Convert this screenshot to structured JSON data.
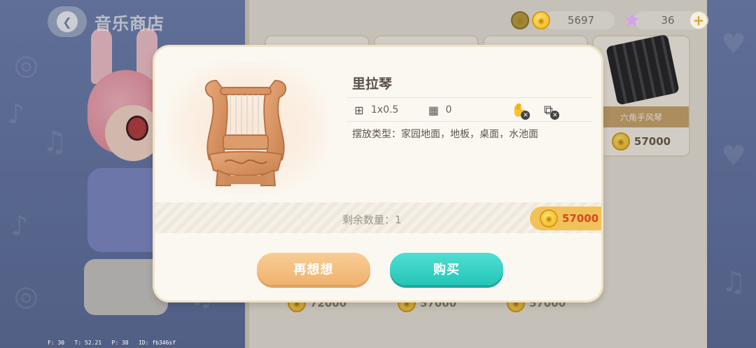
{
  "header": {
    "back_icon": "chevron-left-icon",
    "title": "音乐商店"
  },
  "currency": {
    "coins": "5697",
    "stars": "36",
    "coin_color": "#f0b51e",
    "star_color": "#d59ef0"
  },
  "background_items": {
    "accordion_name": "六角手风琴",
    "accordion_price": "57000",
    "lower_prices": [
      "72000",
      "57000",
      "57000"
    ]
  },
  "modal": {
    "item_name": "里拉琴",
    "size": "1x0.5",
    "capacity": "0",
    "placement_label": "摆放类型：",
    "placement_value": "家园地面，地板，桌面，水池面",
    "stock_label": "剩余数量：",
    "stock_value": "1",
    "price": "57000",
    "cancel_label": "再想想",
    "buy_label": "购买",
    "cancel_color": "#efb26e",
    "buy_color": "#25c5b9"
  },
  "debug": {
    "f": "F: 30",
    "t": "T: 52.21",
    "p": "P: 38",
    "id": "ID: fb346sf"
  }
}
